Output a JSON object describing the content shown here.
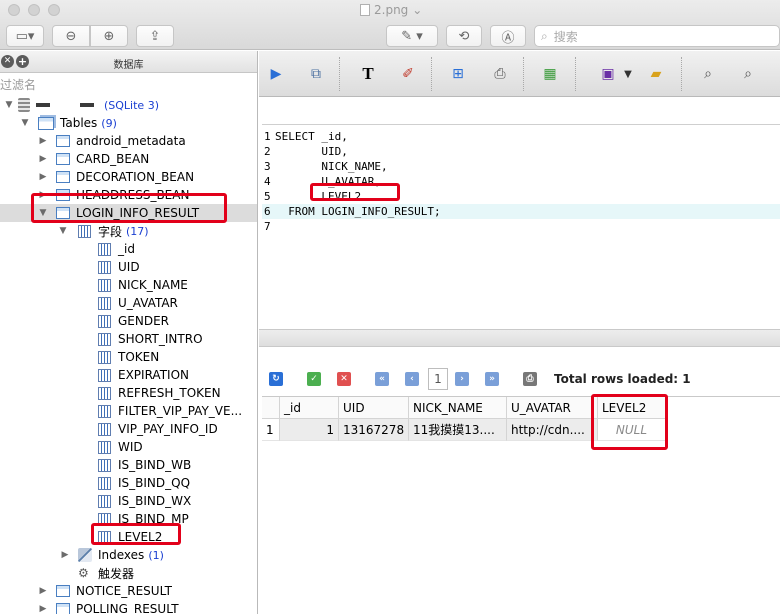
{
  "window": {
    "title": "2.png",
    "title_arrow": "⌄",
    "search_placeholder": "搜索"
  },
  "left_pane": {
    "header_title": "数据库",
    "filter_label": "过滤名",
    "database": {
      "name_suffix": "(SQLite 3)"
    },
    "tables_node": {
      "label": "Tables",
      "count": "(9)"
    },
    "tables": [
      "android_metadata",
      "CARD_BEAN",
      "DECORATION_BEAN",
      "HEADDRESS_BEAN",
      "LOGIN_INFO_RESULT"
    ],
    "fields_node": {
      "label": "字段",
      "count": "(17)"
    },
    "fields": [
      "_id",
      "UID",
      "NICK_NAME",
      "U_AVATAR",
      "GENDER",
      "SHORT_INTRO",
      "TOKEN",
      "EXPIRATION",
      "REFRESH_TOKEN",
      "FILTER_VIP_PAY_VE...",
      "VIP_PAY_INFO_ID",
      "WID",
      "IS_BIND_WB",
      "IS_BIND_QQ",
      "IS_BIND_WX",
      "IS_BIND_MP",
      "LEVEL2"
    ],
    "indexes_node": {
      "label": "Indexes",
      "count": "(1)"
    },
    "triggers_node": {
      "label": "触发器"
    },
    "more_tables": [
      "NOTICE_RESULT",
      "POLLING_RESULT"
    ]
  },
  "editor": {
    "lines": [
      {
        "num": "1",
        "text": "SELECT _id,"
      },
      {
        "num": "2",
        "text": "       UID,"
      },
      {
        "num": "3",
        "text": "       NICK_NAME,"
      },
      {
        "num": "4",
        "text": "       U_AVATAR,"
      },
      {
        "num": "5",
        "text": "       LEVEL2"
      },
      {
        "num": "6",
        "text": "  FROM LOGIN_INFO_RESULT;"
      },
      {
        "num": "7",
        "text": ""
      }
    ]
  },
  "results": {
    "page": "1",
    "status": "Total rows loaded: 1",
    "columns": [
      "_id",
      "UID",
      "NICK_NAME",
      "U_AVATAR",
      "LEVEL2"
    ],
    "rows": [
      {
        "row_num": "1",
        "cells": [
          "1",
          "13167278",
          "11我摸摸13....",
          "http://cdn....",
          "NULL"
        ]
      }
    ]
  },
  "colors": {
    "annotation_red": "#e2001a",
    "count_blue": "#1a3fd1",
    "current_line": "#e6f7f9"
  }
}
